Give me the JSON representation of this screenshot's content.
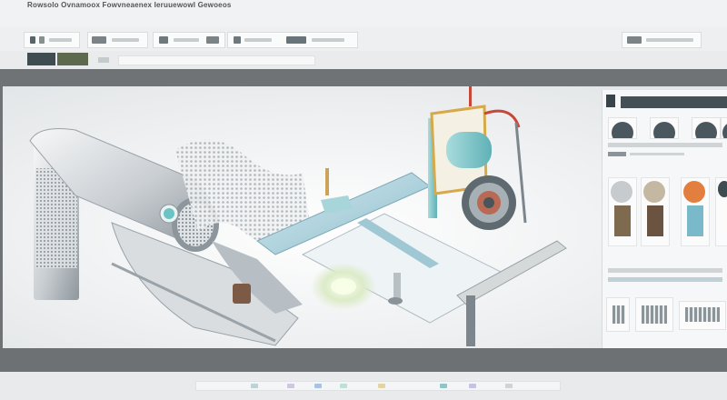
{
  "window": {
    "title": "Rowsolo Ovnamoox Fowvneaenex Ieruuewowl Gewoeos"
  },
  "toolbar": {
    "groups": [
      "toolbar-group-file",
      "toolbar-group-edit",
      "toolbar-group-view",
      "toolbar-group-tools",
      "toolbar-group-help"
    ]
  },
  "tabs": [
    {
      "id": "tab-1",
      "color": "#3f4d52"
    },
    {
      "id": "tab-2",
      "color": "#5d6a4d"
    }
  ],
  "panel": {
    "thumbs": [
      "thumb-1",
      "thumb-2",
      "thumb-3",
      "thumb-4"
    ],
    "vials": [
      {
        "id": "vial-1",
        "fill": "#c7cbcd",
        "accent": "#7d6a4f"
      },
      {
        "id": "vial-2",
        "fill": "#c4b8a3",
        "accent": "#6a5441"
      },
      {
        "id": "vial-3",
        "fill": "#dab08a",
        "accent": "#e27f3f"
      },
      {
        "id": "vial-4",
        "fill": "#7ab9c9",
        "accent": "#3d4c52"
      }
    ]
  },
  "status": {
    "swatches": [
      "#bfd2d6",
      "#cfc6e0",
      "#a9c4e2",
      "#bfe0d2",
      "#e4d4a2",
      "#8fc6c4",
      "#c9c1e3",
      "#cfd3d6"
    ]
  },
  "colors": {
    "frame": "#6f7375",
    "accent_teal": "#7fc7c9",
    "accent_gold": "#d6a94a",
    "accent_red": "#c7473a",
    "panel_header": "#455056"
  }
}
